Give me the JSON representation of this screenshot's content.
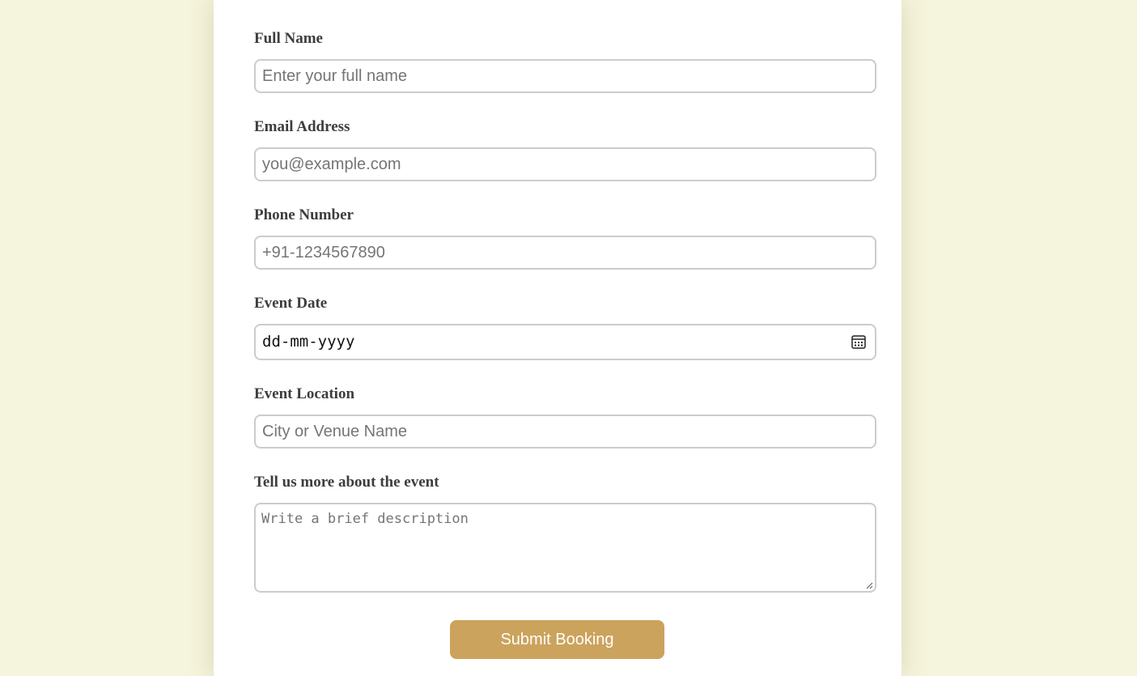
{
  "form": {
    "full_name": {
      "label": "Full Name",
      "placeholder": "Enter your full name"
    },
    "email": {
      "label": "Email Address",
      "placeholder": "you@example.com"
    },
    "phone": {
      "label": "Phone Number",
      "placeholder": "+91-1234567890"
    },
    "event_date": {
      "label": "Event Date",
      "value": "dd-mm-yyyy",
      "icon": "calendar-icon"
    },
    "location": {
      "label": "Event Location",
      "placeholder": "City or Venue Name"
    },
    "description": {
      "label": "Tell us more about the event",
      "placeholder": "Write a brief description"
    },
    "submit_label": "Submit Booking"
  },
  "colors": {
    "page_background": "#f5f4dc",
    "card_background": "#ffffff",
    "button_background": "#cba35c",
    "input_border": "#cccccc",
    "label_text": "#3d3d3d"
  }
}
